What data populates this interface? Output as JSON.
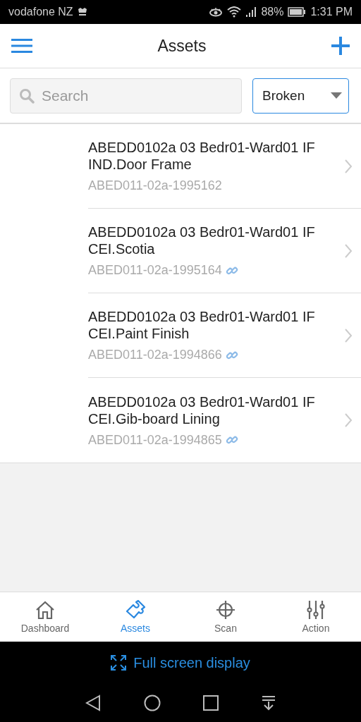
{
  "status_bar": {
    "carrier": "vodafone NZ",
    "battery": "88%",
    "time": "1:31 PM"
  },
  "header": {
    "title": "Assets"
  },
  "search": {
    "placeholder": "Search"
  },
  "filter": {
    "value": "Broken"
  },
  "assets": [
    {
      "title": "ABEDD0102a 03 Bedr01-Ward01 IF IND.Door Frame",
      "code": "ABED011-02a-1995162",
      "linked": false
    },
    {
      "title": "ABEDD0102a 03 Bedr01-Ward01 IF CEI.Scotia",
      "code": "ABED011-02a-1995164",
      "linked": true
    },
    {
      "title": "ABEDD0102a 03 Bedr01-Ward01 IF CEI.Paint Finish",
      "code": "ABED011-02a-1994866",
      "linked": true
    },
    {
      "title": "ABEDD0102a 03 Bedr01-Ward01 IF CEI.Gib-board Lining",
      "code": "ABED011-02a-1994865",
      "linked": true
    }
  ],
  "tabs": [
    {
      "label": "Dashboard",
      "kind": "home",
      "selected": false
    },
    {
      "label": "Assets",
      "kind": "puzzle",
      "selected": true
    },
    {
      "label": "Scan",
      "kind": "crosshair",
      "selected": false
    },
    {
      "label": "Action",
      "kind": "sliders",
      "selected": false
    }
  ],
  "full_screen": {
    "label": "Full screen display"
  }
}
